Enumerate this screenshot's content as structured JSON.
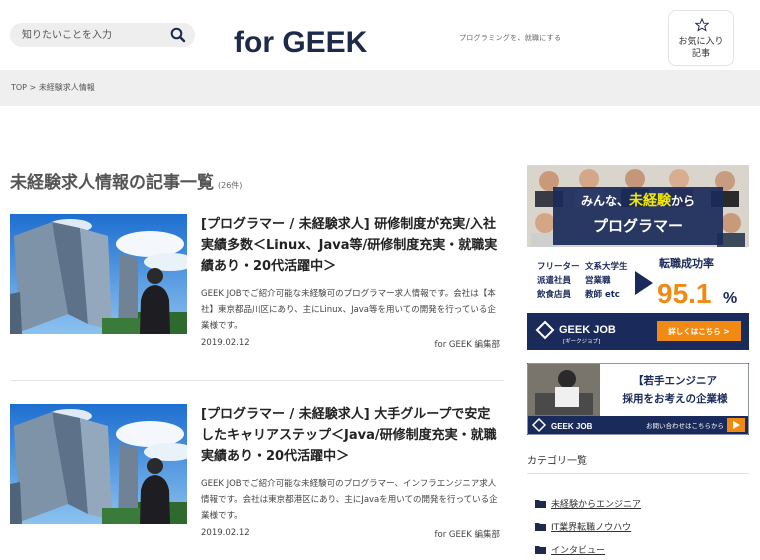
{
  "header": {
    "search_placeholder": "知りたいことを入力",
    "logo_text": "for GEEK",
    "tagline": "プログラミングを、就職にする",
    "favorites_label": "お気に入り\n記事"
  },
  "breadcrumb": {
    "home": "TOP",
    "separator": " > ",
    "current": "未経験求人情報"
  },
  "main": {
    "title": "未経験求人情報の記事一覧",
    "count": "(26件)",
    "articles": [
      {
        "title": "[プログラマー / 未経験求人] 研修制度が充実/入社実績多数＜Linux、Java等/研修制度充実・就職実績あり・20代活躍中＞",
        "excerpt": "GEEK JOBでご紹介可能な未経験可のプログラマー求人情報です。会社は【本社】東京都品川区にあり、主にLinux、Java等を用いての開発を行っている企業様です。",
        "date": "2019.02.12",
        "author": "for GEEK 編集部"
      },
      {
        "title": "[プログラマー / 未経験求人] 大手グループで安定したキャリアステップ＜Java/研修制度充実・就職実績あり・20代活躍中＞",
        "excerpt": "GEEK JOBでご紹介可能な未経験可のプログラマー、インフラエンジニア求人情報です。会社は東京都港区にあり、主にJavaを用いての開発を行っている企業様です。",
        "date": "2019.02.12",
        "author": "for GEEK 編集部"
      }
    ]
  },
  "sidebar": {
    "ad1": {
      "headline_a": "みんな、",
      "headline_b": "未経験",
      "headline_c": "から",
      "headline_2": "プログラマー",
      "roles_left": [
        "フリーター",
        "派遣社員",
        "飲食店員"
      ],
      "roles_right": [
        "文系大学生",
        "営業職",
        "教師 etc"
      ],
      "rate_label": "転職成功率",
      "rate_value": "95.1",
      "rate_unit": "%",
      "brand": "GEEK JOB",
      "brand_kana": "[ギークジョブ]",
      "cta": "詳しくはこちら >"
    },
    "ad2": {
      "headline_1": "【若手エンジニア",
      "headline_2": "採用をお考えの企業様",
      "brand": "GEEK JOB",
      "cta": "お問い合わせはこちらから"
    },
    "categories_heading": "カテゴリ一覧",
    "categories": [
      "未経験からエンジニア",
      "IT業界転職ノウハウ",
      "インタビュー"
    ]
  },
  "colors": {
    "logo": "#1e2a4a",
    "ad_navy": "#1a2a5a",
    "ad_orange": "#f08a12",
    "ad_yellow": "#f2e800",
    "folder": "#1e2a4a"
  }
}
